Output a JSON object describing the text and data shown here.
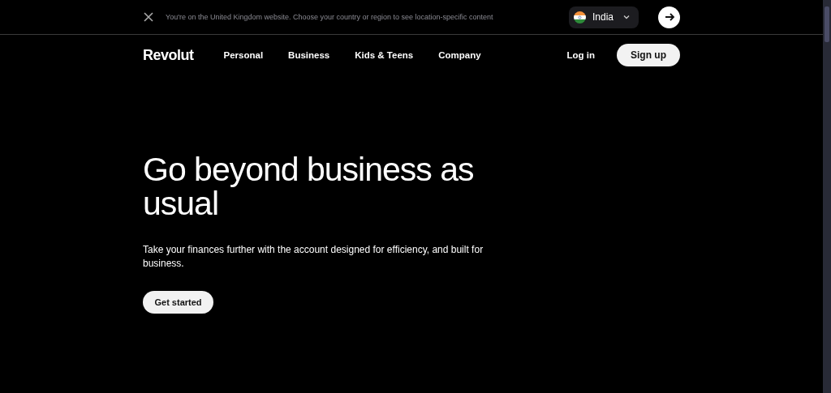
{
  "banner": {
    "message": "You're on the United Kingdom website. Choose your country or region to see location-specific content",
    "country": "India"
  },
  "nav": {
    "logo": "Revolut",
    "links": [
      "Personal",
      "Business",
      "Kids & Teens",
      "Company"
    ],
    "login": "Log in",
    "signup": "Sign up"
  },
  "hero": {
    "title": "Go beyond business as usual",
    "subtitle": "Take your finances further with the account designed for efficiency, and built for business.",
    "cta": "Get started"
  }
}
